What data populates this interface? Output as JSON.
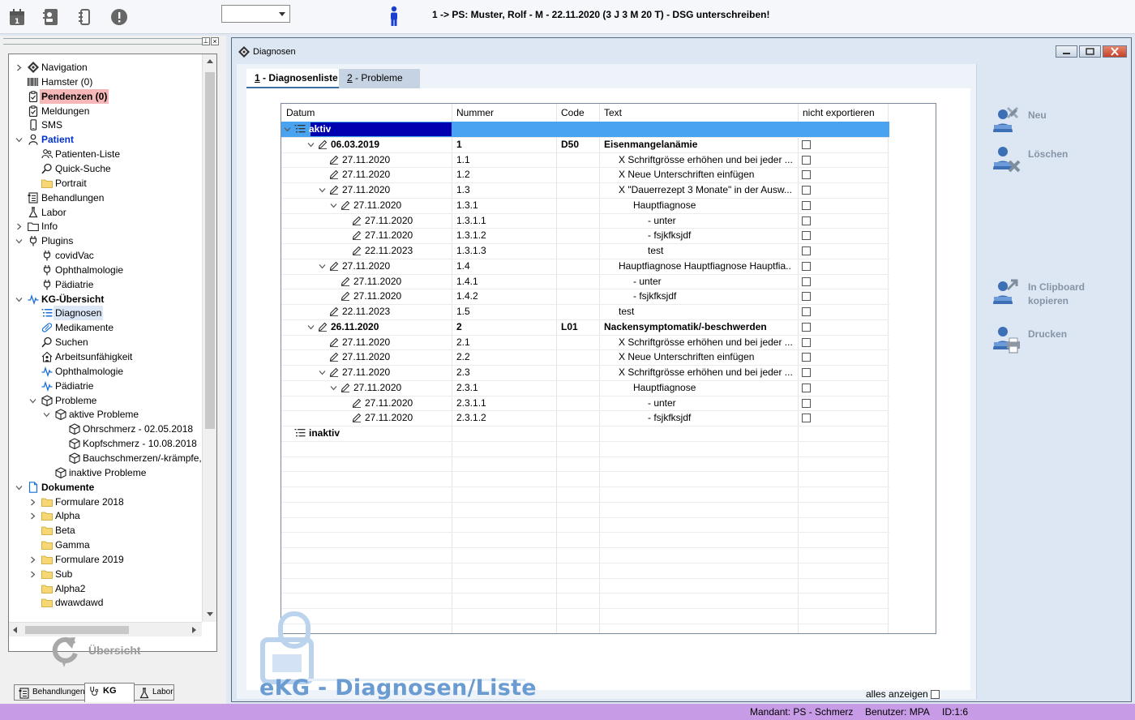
{
  "patient": {
    "title": "1 -> PS: Muster, Rolf - M - 22.11.2020 (3 J 3 M 20 T) - DSG unterschreiben!"
  },
  "toolbar": {
    "icons": [
      "calendar-icon",
      "contact-card-icon",
      "list-icon",
      "alert-icon"
    ],
    "select_value": ""
  },
  "tree": {
    "nodes": [
      {
        "label": "Navigation",
        "icon": "navigation-icon",
        "depth": 0,
        "exp": "collapsed"
      },
      {
        "label": "Hamster (0)",
        "icon": "barcode-icon",
        "depth": 0,
        "exp": "none"
      },
      {
        "label": "Pendenzen (0)",
        "icon": "clipboard-icon",
        "depth": 0,
        "exp": "none",
        "style": "pending"
      },
      {
        "label": "Meldungen",
        "icon": "clipboard-icon",
        "depth": 0,
        "exp": "none"
      },
      {
        "label": "SMS",
        "icon": "phone-icon",
        "depth": 0,
        "exp": "none"
      },
      {
        "label": "Patient",
        "icon": "person-icon",
        "depth": 0,
        "exp": "expanded",
        "style": "bold-blue"
      },
      {
        "label": "Patienten-Liste",
        "icon": "people-icon",
        "depth": 1,
        "exp": "none"
      },
      {
        "label": "Quick-Suche",
        "icon": "search-icon",
        "depth": 1,
        "exp": "none"
      },
      {
        "label": "Portrait",
        "icon": "folder-icon",
        "depth": 1,
        "exp": "none"
      },
      {
        "label": "Behandlungen",
        "icon": "treatment-icon",
        "depth": 0,
        "exp": "none"
      },
      {
        "label": "Labor",
        "icon": "flask-icon",
        "depth": 0,
        "exp": "none"
      },
      {
        "label": "Info",
        "icon": "folder-outline-icon",
        "depth": 0,
        "exp": "collapsed"
      },
      {
        "label": "Plugins",
        "icon": "plug-icon",
        "depth": 0,
        "exp": "expanded"
      },
      {
        "label": "covidVac",
        "icon": "plug-icon",
        "depth": 1,
        "exp": "none"
      },
      {
        "label": "Ophthalmologie",
        "icon": "plug-icon",
        "depth": 1,
        "exp": "none"
      },
      {
        "label": "Pädiatrie",
        "icon": "plug-icon",
        "depth": 1,
        "exp": "none"
      },
      {
        "label": "KG-Übersicht",
        "icon": "pulse-icon",
        "depth": 0,
        "exp": "expanded",
        "style": "bold"
      },
      {
        "label": "Diagnosen",
        "icon": "list-icon",
        "depth": 1,
        "exp": "none",
        "style": "selected"
      },
      {
        "label": "Medikamente",
        "icon": "pill-icon",
        "depth": 1,
        "exp": "none"
      },
      {
        "label": "Suchen",
        "icon": "search-icon",
        "depth": 1,
        "exp": "none"
      },
      {
        "label": "Arbeitsunfähigkeit",
        "icon": "house-person-icon",
        "depth": 1,
        "exp": "none"
      },
      {
        "label": "Ophthalmologie",
        "icon": "pulse-icon",
        "depth": 1,
        "exp": "none"
      },
      {
        "label": "Pädiatrie",
        "icon": "pulse-icon",
        "depth": 1,
        "exp": "none"
      },
      {
        "label": "Probleme",
        "icon": "cube-icon",
        "depth": 1,
        "exp": "expanded"
      },
      {
        "label": "aktive Probleme",
        "icon": "cube-icon",
        "depth": 2,
        "exp": "expanded"
      },
      {
        "label": "Ohrschmerz - 02.05.2018",
        "icon": "cube-icon",
        "depth": 3,
        "exp": "none"
      },
      {
        "label": "Kopfschmerz - 10.08.2018",
        "icon": "cube-icon",
        "depth": 3,
        "exp": "none"
      },
      {
        "label": "Bauchschmerzen/-krämpfe,",
        "icon": "cube-icon",
        "depth": 3,
        "exp": "none"
      },
      {
        "label": "inaktive Probleme",
        "icon": "cube-icon",
        "depth": 2,
        "exp": "none"
      },
      {
        "label": "Dokumente",
        "icon": "document-icon",
        "depth": 0,
        "exp": "expanded",
        "style": "bold"
      },
      {
        "label": "Formulare 2018",
        "icon": "folder-icon",
        "depth": 1,
        "exp": "collapsed"
      },
      {
        "label": "Alpha",
        "icon": "folder-icon",
        "depth": 1,
        "exp": "collapsed"
      },
      {
        "label": "Beta",
        "icon": "folder-icon",
        "depth": 1,
        "exp": "none"
      },
      {
        "label": "Gamma",
        "icon": "folder-icon",
        "depth": 1,
        "exp": "none"
      },
      {
        "label": "Formulare 2019",
        "icon": "folder-icon",
        "depth": 1,
        "exp": "collapsed"
      },
      {
        "label": "Sub",
        "icon": "folder-icon",
        "depth": 1,
        "exp": "collapsed"
      },
      {
        "label": "Alpha2",
        "icon": "folder-icon",
        "depth": 1,
        "exp": "none"
      },
      {
        "label": "dwawdawd",
        "icon": "folder-icon",
        "depth": 1,
        "exp": "none"
      }
    ]
  },
  "left_panel": {
    "overview_button": "Übersicht",
    "tabs": [
      {
        "label": "Behandlungen",
        "icon": "treatment-icon",
        "active": false
      },
      {
        "label": "KG",
        "icon": "stethoscope-icon",
        "active": true
      },
      {
        "label": "Labor",
        "icon": "flask-icon",
        "active": false
      }
    ]
  },
  "window": {
    "title": "Diagnosen",
    "tabs": [
      {
        "key": "1",
        "label": " - Diagnosenliste",
        "active": true
      },
      {
        "key": "2",
        "label": " - Probleme",
        "active": false
      }
    ]
  },
  "grid": {
    "columns": [
      "Datum",
      "Nummer",
      "Code",
      "Text",
      "nicht exportieren"
    ],
    "rows": [
      {
        "kind": "group",
        "label": "aktiv",
        "selected": true,
        "exp": "expanded"
      },
      {
        "kind": "item",
        "level": 1,
        "exp": "expanded",
        "bold": true,
        "datum": "06.03.2019",
        "nummer": "1",
        "code": "D50",
        "text": "Eisenmangelanämie",
        "text_indent": 0
      },
      {
        "kind": "item",
        "level": 2,
        "exp": "none",
        "datum": "27.11.2020",
        "nummer": "1.1",
        "code": "",
        "text": "X Schriftgrösse erhöhen und bei jeder ...",
        "text_indent": 1
      },
      {
        "kind": "item",
        "level": 2,
        "exp": "none",
        "datum": "27.11.2020",
        "nummer": "1.2",
        "code": "",
        "text": "X Neue Unterschriften einfügen",
        "text_indent": 1
      },
      {
        "kind": "item",
        "level": 2,
        "exp": "expanded",
        "datum": "27.11.2020",
        "nummer": "1.3",
        "code": "",
        "text": "X \"Dauerrezept 3 Monate\" in der Ausw...",
        "text_indent": 1
      },
      {
        "kind": "item",
        "level": 3,
        "exp": "expanded",
        "datum": "27.11.2020",
        "nummer": "1.3.1",
        "code": "",
        "text": "Hauptfiagnose",
        "text_indent": 2
      },
      {
        "kind": "item",
        "level": 4,
        "exp": "none",
        "datum": "27.11.2020",
        "nummer": "1.3.1.1",
        "code": "",
        "text": "- unter",
        "text_indent": 3
      },
      {
        "kind": "item",
        "level": 4,
        "exp": "none",
        "datum": "27.11.2020",
        "nummer": "1.3.1.2",
        "code": "",
        "text": "- fsjkfksjdf",
        "text_indent": 3
      },
      {
        "kind": "item",
        "level": 4,
        "exp": "none",
        "datum": "22.11.2023",
        "nummer": "1.3.1.3",
        "code": "",
        "text": "test",
        "text_indent": 3
      },
      {
        "kind": "item",
        "level": 2,
        "exp": "expanded",
        "datum": "27.11.2020",
        "nummer": "1.4",
        "code": "",
        "text": "Hauptfiagnose Hauptfiagnose Hauptfia...",
        "text_indent": 1
      },
      {
        "kind": "item",
        "level": 3,
        "exp": "none",
        "datum": "27.11.2020",
        "nummer": "1.4.1",
        "code": "",
        "text": "- unter",
        "text_indent": 2
      },
      {
        "kind": "item",
        "level": 3,
        "exp": "none",
        "datum": "27.11.2020",
        "nummer": "1.4.2",
        "code": "",
        "text": "- fsjkfksjdf",
        "text_indent": 2
      },
      {
        "kind": "item",
        "level": 2,
        "exp": "none",
        "datum": "22.11.2023",
        "nummer": "1.5",
        "code": "",
        "text": "test",
        "text_indent": 1
      },
      {
        "kind": "item",
        "level": 1,
        "exp": "expanded",
        "bold": true,
        "datum": "26.11.2020",
        "nummer": "2",
        "code": "L01",
        "text": "Nackensymptomatik/-beschwerden",
        "text_indent": 0
      },
      {
        "kind": "item",
        "level": 2,
        "exp": "none",
        "datum": "27.11.2020",
        "nummer": "2.1",
        "code": "",
        "text": "X Schriftgrösse erhöhen und bei jeder ...",
        "text_indent": 1
      },
      {
        "kind": "item",
        "level": 2,
        "exp": "none",
        "datum": "27.11.2020",
        "nummer": "2.2",
        "code": "",
        "text": "X Neue Unterschriften einfügen",
        "text_indent": 1
      },
      {
        "kind": "item",
        "level": 2,
        "exp": "expanded",
        "datum": "27.11.2020",
        "nummer": "2.3",
        "code": "",
        "text": "X Schriftgrösse erhöhen und bei jeder ...",
        "text_indent": 1
      },
      {
        "kind": "item",
        "level": 3,
        "exp": "expanded",
        "datum": "27.11.2020",
        "nummer": "2.3.1",
        "code": "",
        "text": "Hauptfiagnose",
        "text_indent": 2
      },
      {
        "kind": "item",
        "level": 4,
        "exp": "none",
        "datum": "27.11.2020",
        "nummer": "2.3.1.1",
        "code": "",
        "text": "- unter",
        "text_indent": 3
      },
      {
        "kind": "item",
        "level": 4,
        "exp": "none",
        "datum": "27.11.2020",
        "nummer": "2.3.1.2",
        "code": "",
        "text": "- fsjkfksjdf",
        "text_indent": 3
      },
      {
        "kind": "group",
        "label": "inaktiv",
        "selected": false,
        "exp": "none"
      }
    ]
  },
  "list_footer": {
    "watermark": "eKG - Diagnosen/Liste",
    "show_all_label": "alles anzeigen"
  },
  "actions": [
    {
      "label": "Neu",
      "icon": "new-user-icon"
    },
    {
      "label": "Löschen",
      "icon": "delete-user-icon"
    },
    {
      "label": "In Clipboard\nkopieren",
      "icon": "clipboard-user-icon"
    },
    {
      "label": "Drucken",
      "icon": "print-user-icon"
    }
  ],
  "status": {
    "mandant": "Mandant: PS - Schmerz",
    "benutzer": "Benutzer: MPA",
    "id": "ID:1:6"
  },
  "colors": {
    "selection": "#4aa3f0",
    "group_label": "#0000b0",
    "status_bar": "#c89be6",
    "accent": "#3a6ea5"
  }
}
